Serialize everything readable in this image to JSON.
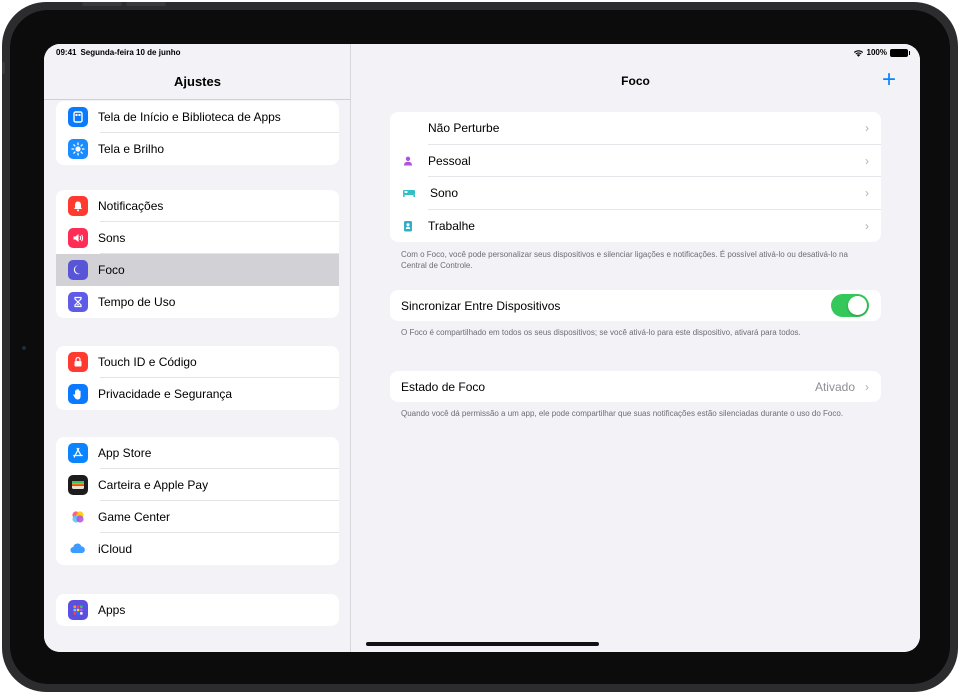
{
  "status": {
    "time": "09:41",
    "date": "Segunda-feira 10 de junho",
    "battery": "100%"
  },
  "sidebar": {
    "title": "Ajustes",
    "groups": [
      [
        {
          "label": "Tela de Início e Biblioteca de Apps",
          "icon": "home-screen-icon",
          "color": "#0a7bff"
        },
        {
          "label": "Tela e Brilho",
          "icon": "brightness-icon",
          "color": "#1a8cff"
        }
      ],
      [
        {
          "label": "Notificações",
          "icon": "bell-icon",
          "color": "#ff3b30"
        },
        {
          "label": "Sons",
          "icon": "speaker-icon",
          "color": "#ff2d55"
        },
        {
          "label": "Foco",
          "icon": "moon-icon",
          "color": "#5856d6",
          "selected": true
        },
        {
          "label": "Tempo de Uso",
          "icon": "hourglass-icon",
          "color": "#5e5ce6"
        }
      ],
      [
        {
          "label": "Touch ID e Código",
          "icon": "lock-icon",
          "color": "#ff3b30"
        },
        {
          "label": "Privacidade e Segurança",
          "icon": "hand-icon",
          "color": "#0a7bff"
        }
      ],
      [
        {
          "label": "App Store",
          "icon": "app-store-icon",
          "color": "#0a84ff"
        },
        {
          "label": "Carteira e Apple Pay",
          "icon": "wallet-icon",
          "color": "#1c1c1e"
        },
        {
          "label": "Game Center",
          "icon": "game-center-icon",
          "color": "#ffffff"
        },
        {
          "label": "iCloud",
          "icon": "cloud-icon",
          "color": "#ffffff"
        }
      ],
      [
        {
          "label": "Apps",
          "icon": "apps-grid-icon",
          "color": "#5b4fe0"
        }
      ]
    ]
  },
  "main": {
    "title": "Foco",
    "add_label": "+",
    "focus_modes": [
      {
        "label": "Não Perturbe",
        "icon": "moon-icon",
        "color": "#5856d6"
      },
      {
        "label": "Pessoal",
        "icon": "person-icon",
        "color": "#af52de"
      },
      {
        "label": "Sono",
        "icon": "bed-icon",
        "color": "#30c0c6"
      },
      {
        "label": "Trabalhe",
        "icon": "badge-icon",
        "color": "#30b0c7"
      }
    ],
    "focus_note": "Com o Foco, você pode personalizar seus dispositivos e silenciar ligações e notificações. É possível ativá-lo ou desativá-lo na Central de Controle.",
    "share": {
      "label": "Sincronizar Entre Dispositivos",
      "on": true
    },
    "share_note": "O Foco é compartilhado em todos os seus dispositivos; se você ativá-lo para este dispositivo, ativará para todos.",
    "status": {
      "label": "Estado de Foco",
      "value": "Ativado"
    },
    "status_note": "Quando você dá permissão a um app, ele pode compartilhar que suas notificações estão silenciadas durante o uso do Foco.",
    "chevron": "›"
  },
  "colors": {
    "accent": "#0a84ff",
    "toggle_on": "#34c759"
  }
}
